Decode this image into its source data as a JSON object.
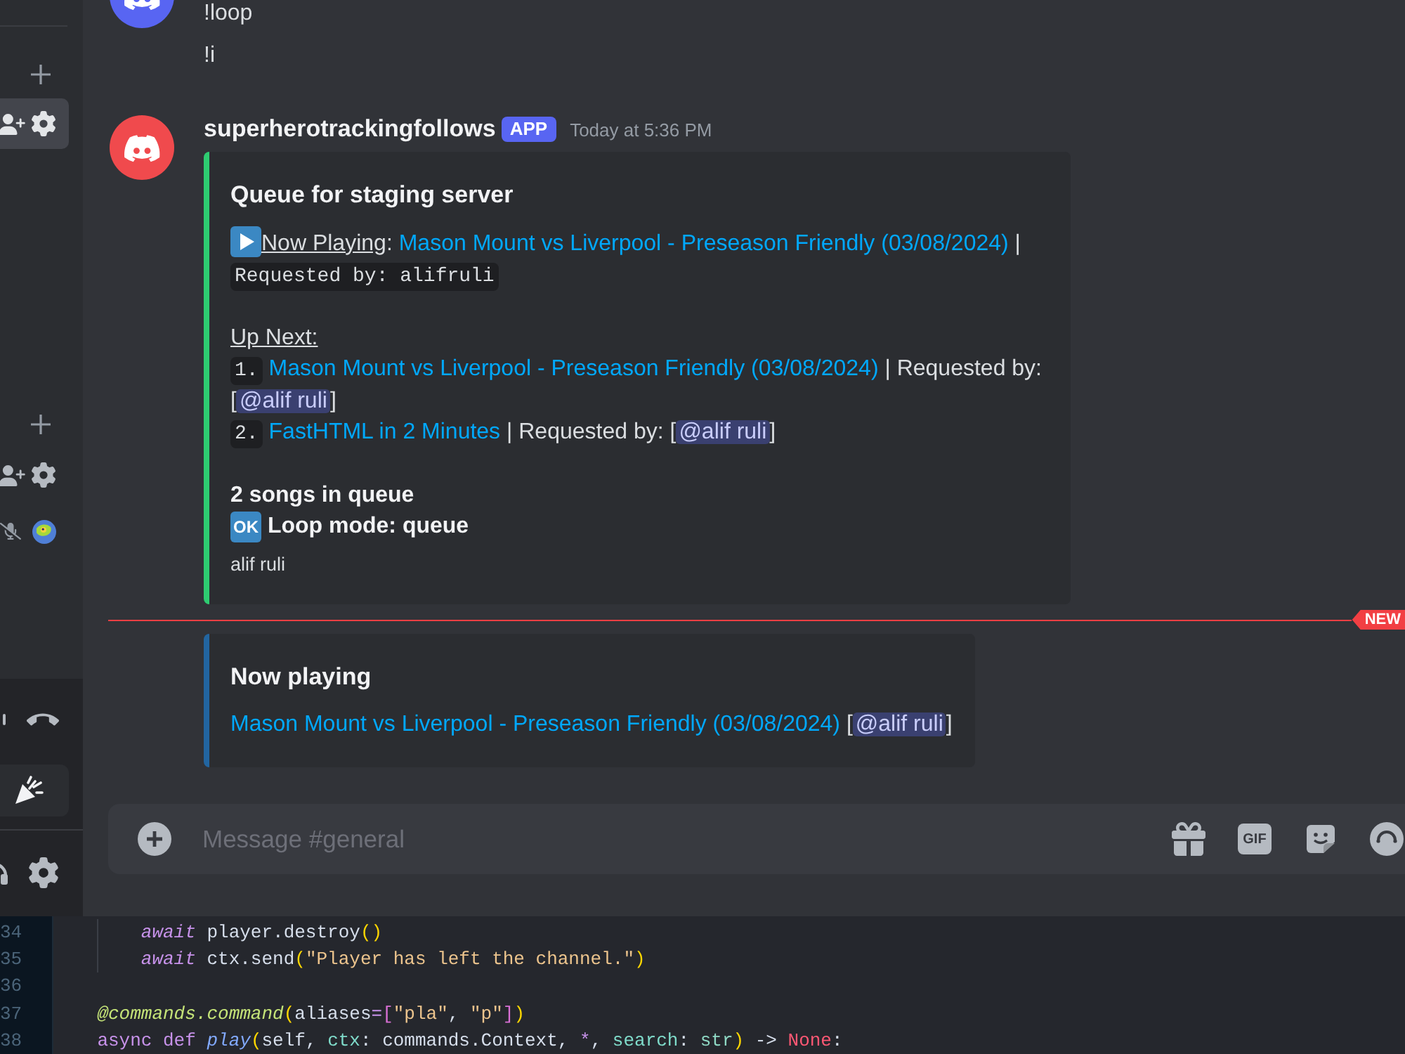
{
  "sidebar": {
    "channel_rows": [
      {
        "selected": true
      },
      {
        "selected": false
      }
    ]
  },
  "earlier_messages": [
    "!loop",
    "!i"
  ],
  "bot_message": {
    "author": "superherotrackingfollows",
    "badge": "APP",
    "timestamp": "Today at 5:36 PM",
    "embed": {
      "title": "Queue for staging server",
      "now_playing": {
        "label": "Now Playing",
        "separator": ":",
        "track": "Mason Mount vs Liverpool - Preseason Friendly (03/08/2024)",
        "after": "|",
        "requested": "Requested by: alifruli"
      },
      "up_next_label": "Up Next:",
      "up_next": [
        {
          "number": "1.",
          "track": "Mason Mount vs Liverpool - Preseason Friendly (03/08/2024)",
          "requested_prefix": "| Requested by: [",
          "mention": "@alif ruli",
          "requested_suffix": "]"
        },
        {
          "number": "2.",
          "track": "FastHTML in 2 Minutes",
          "requested_prefix": "| Requested by: [",
          "mention": "@alif ruli",
          "requested_suffix": "]"
        }
      ],
      "summary": "2 songs in queue",
      "loop": {
        "emoji": "OK",
        "text": "Loop mode: queue"
      },
      "footer": "alif ruli"
    }
  },
  "new_divider": {
    "label": "NEW"
  },
  "followup_embed": {
    "title": "Now playing",
    "track": "Mason Mount vs Liverpool - Preseason Friendly (03/08/2024)",
    "mention_prefix": "[",
    "mention": "@alif ruli",
    "mention_suffix": "]"
  },
  "composer": {
    "placeholder": "Message #general",
    "gif": "GIF"
  },
  "code_editor": {
    "lines": [
      {
        "children": [
          {
            "children": [
              {
                "number": "34",
                "tokens": [
                  {
                    "kind": "keyword",
                    "text": "await"
                  },
                  {
                    "kind": "plain",
                    "text": " player.destroy"
                  },
                  {
                    "kind": "bracket",
                    "text": "()"
                  }
                ]
              },
              {
                "number": "35",
                "tokens": [
                  {
                    "kind": "keyword",
                    "text": "await"
                  },
                  {
                    "kind": "plain",
                    "text": " ctx.send"
                  },
                  {
                    "kind": "bracket",
                    "text": "("
                  },
                  {
                    "kind": "string",
                    "text": "\"Player has left the channel.\""
                  },
                  {
                    "kind": "bracket",
                    "text": ")"
                  }
                ]
              }
            ]
          },
          {
            "number": "36"
          },
          {
            "number": "37",
            "tokens": [
              {
                "kind": "decorator",
                "text": "@commands.command"
              },
              {
                "kind": "bracket",
                "text": "("
              },
              {
                "kind": "plain",
                "text": "aliases"
              },
              {
                "kind": "operator",
                "text": "="
              },
              {
                "kind": "bracket_inner",
                "text": "["
              },
              {
                "kind": "string",
                "text": "\"pla\""
              },
              {
                "kind": "plain",
                "text": ", "
              },
              {
                "kind": "string",
                "text": "\"p\""
              },
              {
                "kind": "bracket_inner",
                "text": "]"
              },
              {
                "kind": "bracket",
                "text": ")"
              }
            ]
          },
          {
            "number": "38",
            "tokens": [
              {
                "kind": "storage",
                "text": "async def "
              },
              {
                "kind": "function",
                "text": "play"
              },
              {
                "kind": "bracket",
                "text": "("
              },
              {
                "kind": "plain",
                "text": "self, "
              },
              {
                "kind": "param",
                "text": "ctx"
              },
              {
                "kind": "plain",
                "text": ": commands.Context, "
              },
              {
                "kind": "operator",
                "text": "*"
              },
              {
                "kind": "plain",
                "text": ", "
              },
              {
                "kind": "param",
                "text": "search"
              },
              {
                "kind": "plain",
                "text": ": "
              },
              {
                "kind": "type",
                "text": "str"
              },
              {
                "kind": "bracket",
                "text": ")"
              },
              {
                "kind": "plain",
                "text": " -> "
              },
              {
                "kind": "constant",
                "text": "None"
              },
              {
                "kind": "plain",
                "text": ":"
              }
            ]
          }
        ]
      }
    ]
  }
}
